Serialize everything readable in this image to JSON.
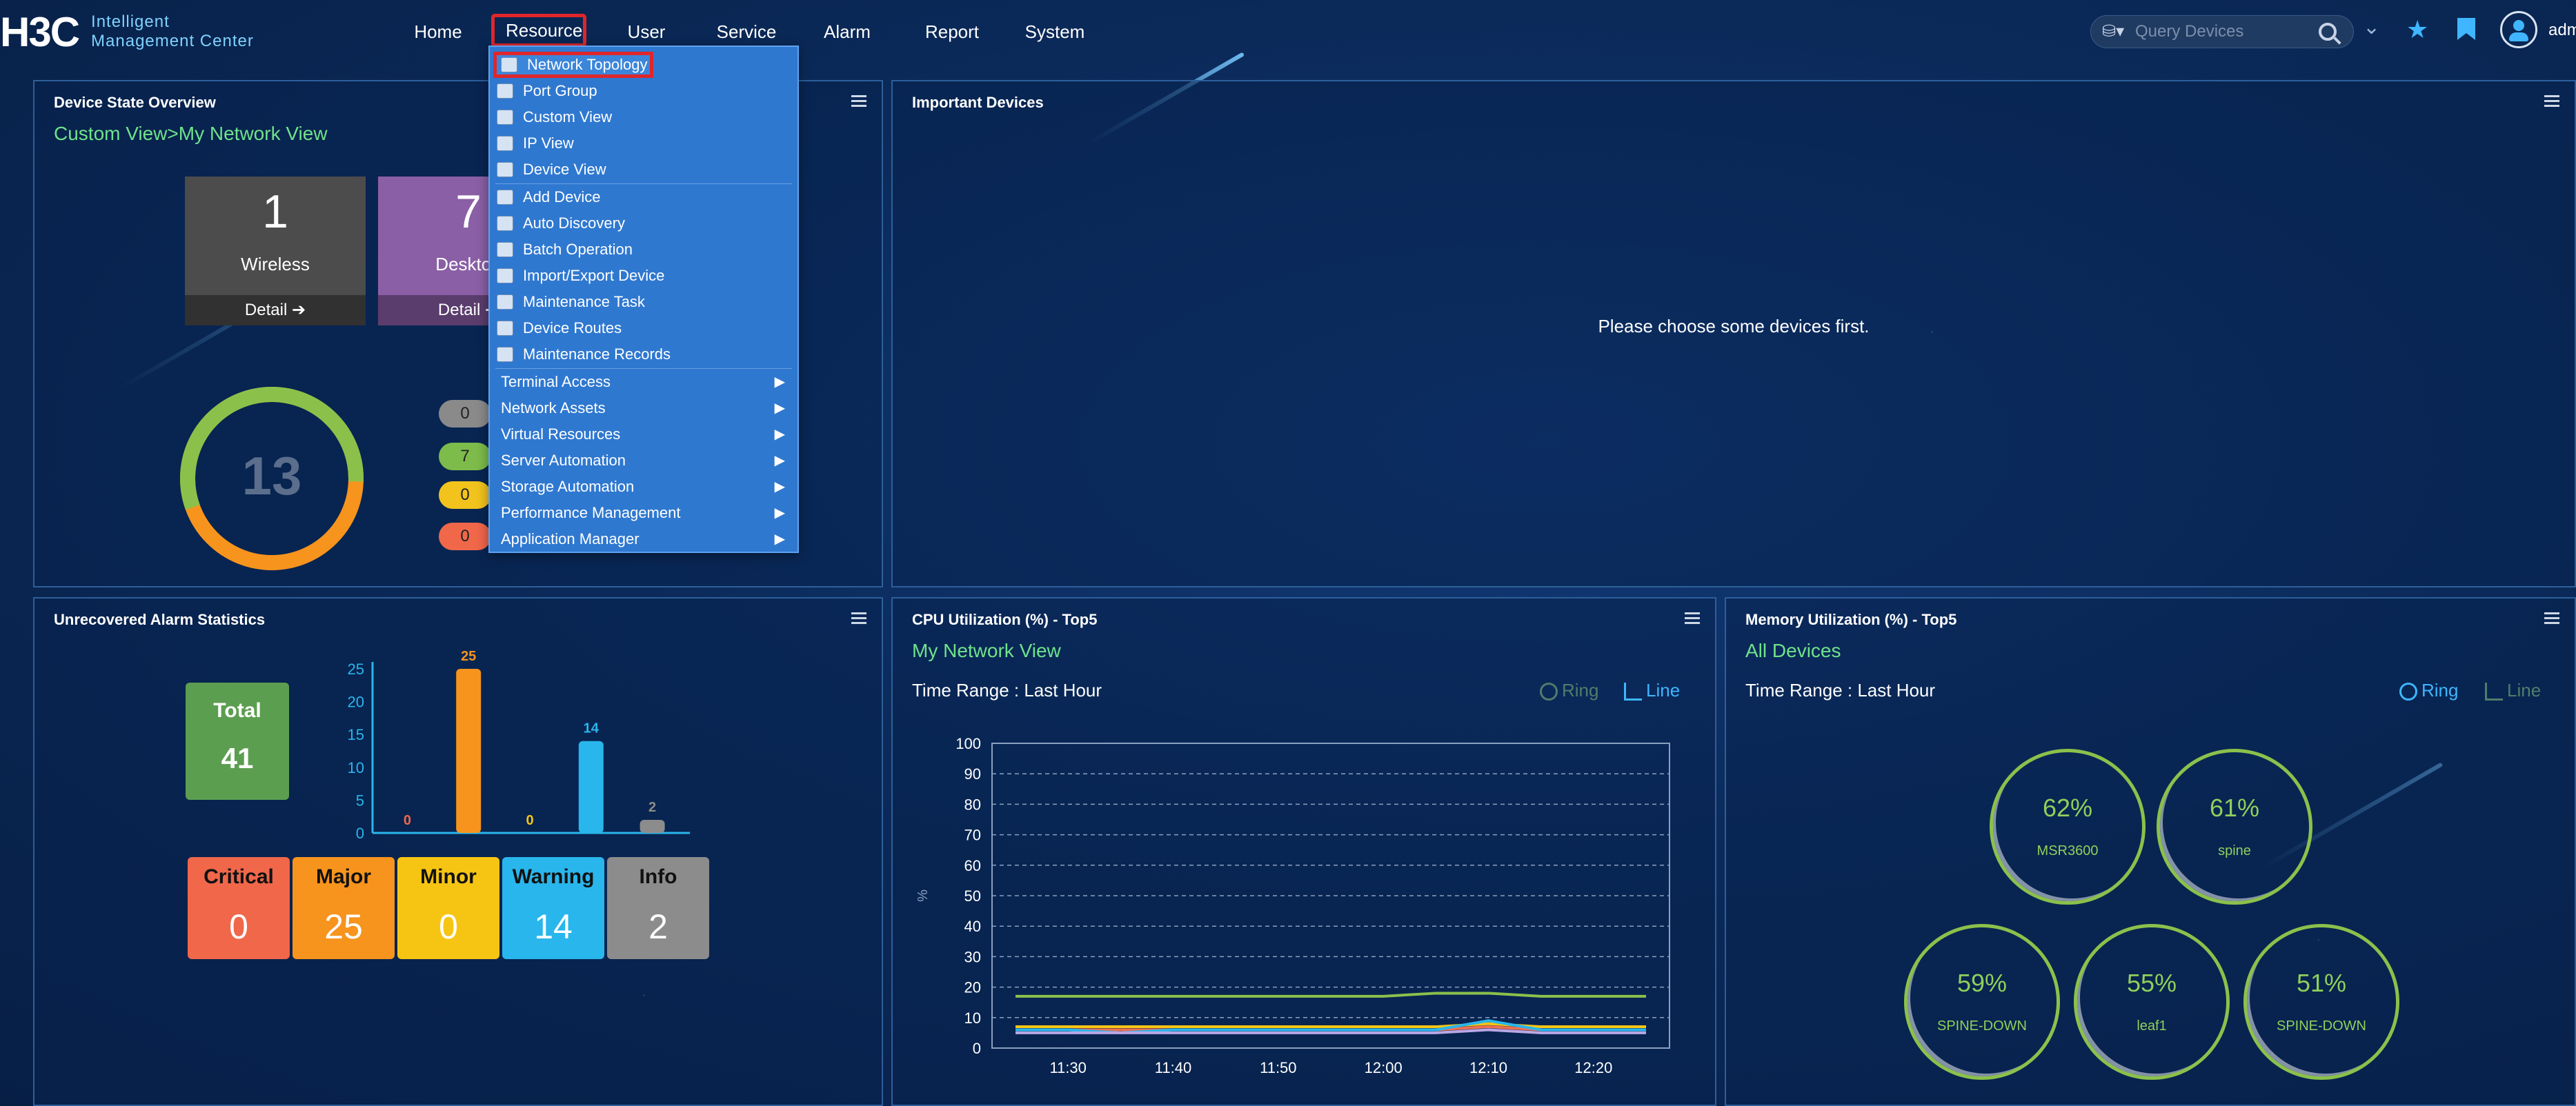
{
  "header": {
    "logo_mark": "H3C",
    "logo_line1": "Intelligent",
    "logo_line2": "Management Center",
    "nav": [
      "Home",
      "Resource",
      "User",
      "Service",
      "Alarm",
      "Report",
      "System"
    ],
    "active_nav": "Resource",
    "search_placeholder": "Query Devices",
    "username": "adm"
  },
  "resource_menu": {
    "items": [
      {
        "label": "Network Topology",
        "icon": "topology-icon",
        "highlighted": true
      },
      {
        "label": "Port Group",
        "icon": "port-group-icon"
      },
      {
        "label": "Custom View",
        "icon": "custom-view-icon"
      },
      {
        "label": "IP View",
        "icon": "ip-view-icon"
      },
      {
        "label": "Device View",
        "icon": "device-view-icon"
      },
      {
        "label": "Add Device",
        "icon": "add-device-icon"
      },
      {
        "label": "Auto Discovery",
        "icon": "auto-discovery-icon"
      },
      {
        "label": "Batch Operation",
        "icon": "batch-operation-icon"
      },
      {
        "label": "Import/Export Device",
        "icon": "import-export-icon"
      },
      {
        "label": "Maintenance Task",
        "icon": "maintenance-task-icon"
      },
      {
        "label": "Device Routes",
        "icon": "device-routes-icon"
      },
      {
        "label": "Maintenance Records",
        "icon": "maintenance-records-icon"
      }
    ],
    "submenus": [
      "Terminal Access",
      "Network Assets",
      "Virtual Resources",
      "Server Automation",
      "Storage Automation",
      "Performance Management",
      "Application Manager"
    ]
  },
  "device_state": {
    "title": "Device State Overview",
    "view_path": "Custom View>My Network View",
    "tiles": [
      {
        "count": "1",
        "label": "Wireless",
        "detail": "Detail"
      },
      {
        "count": "7",
        "label": "Desktop",
        "detail": "Detail"
      }
    ],
    "donut_total": "13",
    "pills": [
      "0",
      "7",
      "0",
      "0"
    ],
    "colors": {
      "pill_gray": "#8a8a8a",
      "pill_green": "#7dbb4a",
      "pill_yellow": "#f2c31c",
      "pill_red": "#f0674a"
    }
  },
  "important_devices": {
    "title": "Important Devices",
    "message": "Please choose some devices first."
  },
  "alarms": {
    "title": "Unrecovered Alarm Statistics",
    "total_label": "Total",
    "total_value": "41",
    "severities": [
      {
        "label": "Critical",
        "value": "0",
        "color": "#f0674a"
      },
      {
        "label": "Major",
        "value": "25",
        "color": "#f7941d"
      },
      {
        "label": "Minor",
        "value": "0",
        "color": "#f6c514"
      },
      {
        "label": "Warning",
        "value": "14",
        "color": "#29b6ec"
      },
      {
        "label": "Info",
        "value": "2",
        "color": "#8c8c8c"
      }
    ]
  },
  "cpu": {
    "title": "CPU Utilization (%) - Top5",
    "view": "My Network View",
    "time_range": "Time Range : Last Hour",
    "ring_label": "Ring",
    "line_label": "Line"
  },
  "memory": {
    "title": "Memory Utilization (%) - Top5",
    "view": "All Devices",
    "time_range": "Time Range : Last Hour",
    "ring_label": "Ring",
    "line_label": "Line",
    "rings": [
      {
        "pct": "62%",
        "name": "MSR3600"
      },
      {
        "pct": "61%",
        "name": "spine"
      },
      {
        "pct": "59%",
        "name": "SPINE-DOWN"
      },
      {
        "pct": "55%",
        "name": "leaf1"
      },
      {
        "pct": "51%",
        "name": "SPINE-DOWN"
      }
    ]
  },
  "chart_data": [
    {
      "type": "bar",
      "categories": [
        "Critical",
        "Major",
        "Minor",
        "Warning",
        "Info"
      ],
      "values": [
        0,
        25,
        0,
        14,
        2
      ],
      "colors": [
        "#f0674a",
        "#f7941d",
        "#f6c514",
        "#29b6ec",
        "#8c8c8c"
      ],
      "ylim": [
        0,
        25
      ],
      "yticks": [
        0,
        5,
        10,
        15,
        20,
        25
      ]
    },
    {
      "type": "line",
      "ylabel": "%",
      "ylim": [
        0,
        100
      ],
      "yticks": [
        0,
        10,
        20,
        30,
        40,
        50,
        60,
        70,
        80,
        90,
        100
      ],
      "x": [
        "11:25",
        "11:30",
        "11:35",
        "11:40",
        "11:45",
        "11:50",
        "11:55",
        "12:00",
        "12:05",
        "12:10",
        "12:15",
        "12:20",
        "12:25"
      ],
      "xticks": [
        "11:30",
        "11:40",
        "11:50",
        "12:00",
        "12:10",
        "12:20"
      ],
      "grid": true,
      "series": [
        {
          "color": "#8bc14b",
          "values": [
            17,
            17,
            17,
            17,
            17,
            17,
            17,
            17,
            18,
            18,
            17,
            17,
            17
          ]
        },
        {
          "color": "#f6c514",
          "values": [
            7,
            7,
            7,
            7,
            7,
            7,
            7,
            7,
            7,
            8,
            7,
            7,
            7
          ]
        },
        {
          "color": "#f07050",
          "values": [
            6,
            6,
            6,
            6,
            6,
            6,
            6,
            6,
            6,
            7,
            6,
            6,
            6
          ]
        },
        {
          "color": "#29b6ec",
          "values": [
            6,
            6,
            5,
            6,
            6,
            6,
            6,
            6,
            6,
            9,
            6,
            6,
            6
          ]
        },
        {
          "color": "#b9a7e6",
          "values": [
            5,
            5,
            5,
            5,
            5,
            5,
            5,
            5,
            5,
            6,
            5,
            5,
            5
          ]
        }
      ]
    }
  ]
}
